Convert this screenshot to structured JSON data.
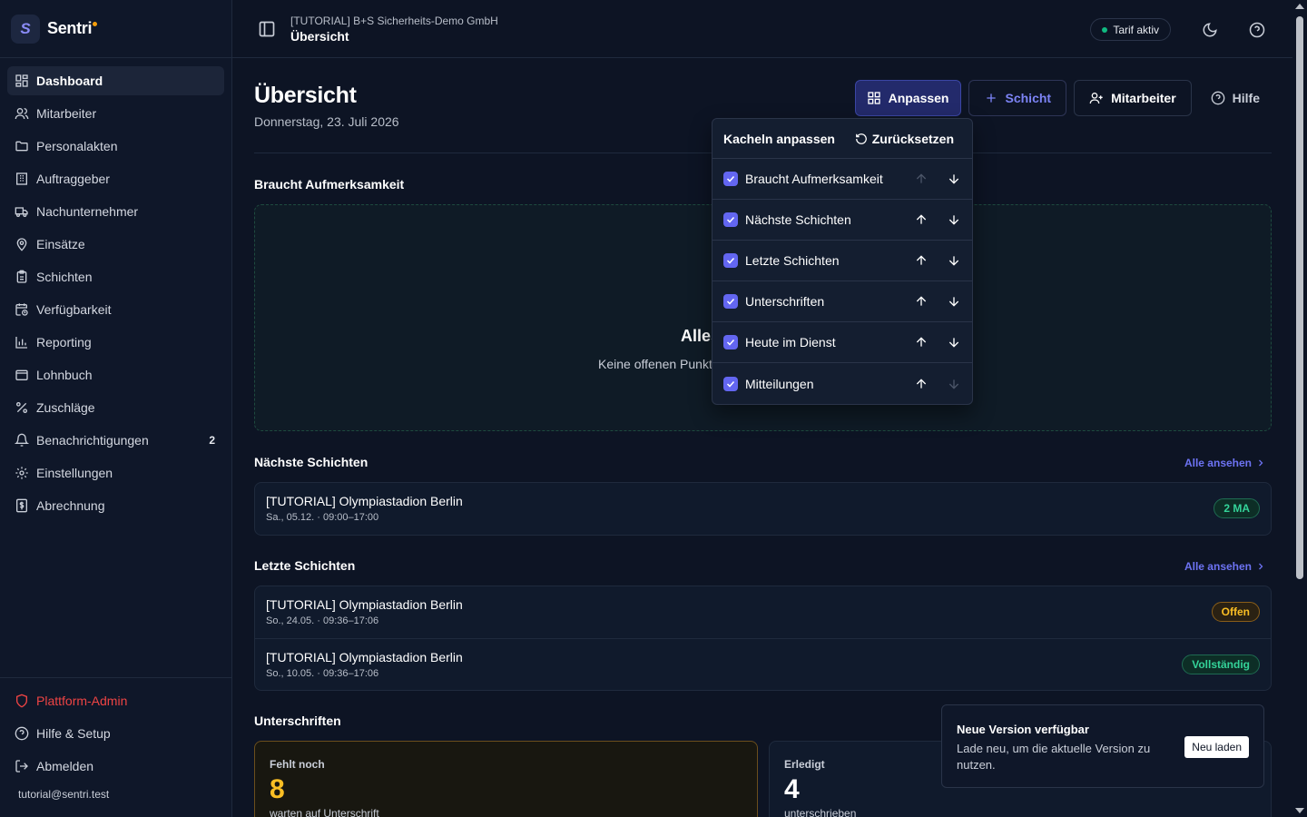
{
  "brand": {
    "name": "Sentri",
    "logo_letter": "S"
  },
  "nav": [
    {
      "label": "Dashboard",
      "icon": "dashboard-icon",
      "active": true
    },
    {
      "label": "Mitarbeiter",
      "icon": "users-icon"
    },
    {
      "label": "Personalakten",
      "icon": "folder-icon"
    },
    {
      "label": "Auftraggeber",
      "icon": "building-icon"
    },
    {
      "label": "Nachunternehmer",
      "icon": "truck-icon"
    },
    {
      "label": "Einsätze",
      "icon": "map-pin-icon"
    },
    {
      "label": "Schichten",
      "icon": "clipboard-icon"
    },
    {
      "label": "Verfügbarkeit",
      "icon": "calendar-clock-icon"
    },
    {
      "label": "Reporting",
      "icon": "bar-chart-icon"
    },
    {
      "label": "Lohnbuch",
      "icon": "book-icon"
    },
    {
      "label": "Zuschläge",
      "icon": "percent-icon"
    },
    {
      "label": "Benachrichtigungen",
      "icon": "bell-icon",
      "badge": "2"
    },
    {
      "label": "Einstellungen",
      "icon": "gear-icon"
    },
    {
      "label": "Abrechnung",
      "icon": "receipt-icon"
    }
  ],
  "footer_nav": [
    {
      "label": "Plattform-Admin",
      "icon": "shield-icon"
    },
    {
      "label": "Hilfe & Setup",
      "icon": "help-circle-icon"
    },
    {
      "label": "Abmelden",
      "icon": "logout-icon"
    }
  ],
  "user": {
    "email": "tutorial@sentri.test"
  },
  "topbar": {
    "org": "[TUTORIAL] B+S Sicherheits-Demo GmbH",
    "page": "Übersicht",
    "tarif": "Tarif aktiv"
  },
  "header": {
    "title": "Übersicht",
    "date": "Donnerstag, 23. Juli 2026",
    "buttons": {
      "customize": "Anpassen",
      "shift": "Schicht",
      "employee": "Mitarbeiter",
      "help": "Hilfe"
    }
  },
  "attention": {
    "title": "Braucht Aufmerksamkeit",
    "empty_title": "Alles",
    "empty_sub": "Keine offenen Punkt"
  },
  "next_shifts": {
    "title": "Nächste Schichten",
    "see_all": "Alle ansehen",
    "rows": [
      {
        "title": "[TUTORIAL] Olympiastadion Berlin",
        "sub": "Sa., 05.12. · 09:00–17:00",
        "pill": "2 MA",
        "pill_color": "#34d399"
      }
    ]
  },
  "last_shifts": {
    "title": "Letzte Schichten",
    "see_all": "Alle ansehen",
    "rows": [
      {
        "title": "[TUTORIAL] Olympiastadion Berlin",
        "sub": "So., 24.05. · 09:36–17:06",
        "pill": "Offen",
        "pill_color": "#fbbf24"
      },
      {
        "title": "[TUTORIAL] Olympiastadion Berlin",
        "sub": "So., 10.05. · 09:36–17:06",
        "pill": "Vollständig",
        "pill_color": "#34d399"
      }
    ]
  },
  "signatures": {
    "title": "Unterschriften",
    "missing": {
      "label": "Fehlt noch",
      "value": "8",
      "sub": "warten auf Unterschrift"
    },
    "done": {
      "label": "Erledigt",
      "value": "4",
      "sub": "unterschrieben"
    }
  },
  "popover": {
    "title": "Kacheln anpassen",
    "reset": "Zurücksetzen",
    "items": [
      {
        "label": "Braucht Aufmerksamkeit",
        "checked": true,
        "up_disabled": true,
        "down_disabled": false
      },
      {
        "label": "Nächste Schichten",
        "checked": true,
        "up_disabled": false,
        "down_disabled": false
      },
      {
        "label": "Letzte Schichten",
        "checked": true,
        "up_disabled": false,
        "down_disabled": false
      },
      {
        "label": "Unterschriften",
        "checked": true,
        "up_disabled": false,
        "down_disabled": false
      },
      {
        "label": "Heute im Dienst",
        "checked": true,
        "up_disabled": false,
        "down_disabled": false
      },
      {
        "label": "Mitteilungen",
        "checked": true,
        "up_disabled": false,
        "down_disabled": true
      }
    ]
  },
  "toast": {
    "title": "Neue Version verfügbar",
    "text": "Lade neu, um die aktuelle Version zu nutzen.",
    "button": "Neu laden"
  },
  "colors": {
    "accent": "#6366f1",
    "danger": "#ef4444",
    "success": "#34d399",
    "warning": "#fbbf24"
  }
}
